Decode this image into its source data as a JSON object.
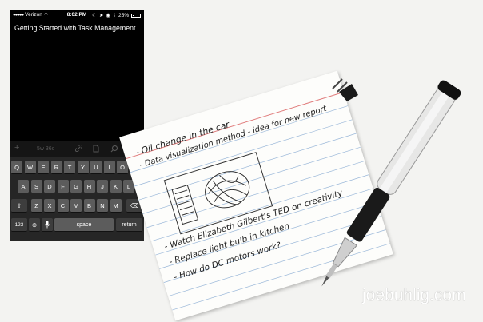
{
  "status_bar": {
    "carrier": "Verizon",
    "time": "8:02 PM",
    "battery": "25%"
  },
  "note": {
    "title": "Getting Started with Task Management"
  },
  "toolbar": {
    "add_icon": "plus-icon",
    "word_count": "5w 36c",
    "link_icon": "link-icon",
    "doc_icon": "document-icon",
    "search_icon": "search-icon",
    "share_icon": "share-icon"
  },
  "keyboard": {
    "row1": [
      "Q",
      "W",
      "E",
      "R",
      "T",
      "Y",
      "U",
      "I",
      "O",
      "P"
    ],
    "row2": [
      "A",
      "S",
      "D",
      "F",
      "G",
      "H",
      "J",
      "K",
      "L"
    ],
    "row3": [
      "Z",
      "X",
      "C",
      "V",
      "B",
      "N",
      "M"
    ],
    "shift_icon": "shift-icon",
    "delete_icon": "delete-icon",
    "numbers_label": "123",
    "globe_icon": "globe-icon",
    "mic_icon": "microphone-icon",
    "space_label": "space",
    "return_label": "return"
  },
  "card": {
    "line1": "- Oil change in the car",
    "line2": "- Data visualization method - idea for new report",
    "line3": "- Watch Elizabeth Gilbert's TED on creativity",
    "line4": "- Replace light bulb in kitchen",
    "line5": "- How do DC motors work?"
  },
  "watermark": "joebuhlig.com"
}
